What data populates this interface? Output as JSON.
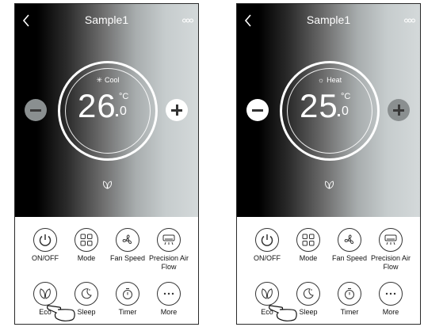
{
  "screens": [
    {
      "title": "Sample1",
      "mode_label": "Cool",
      "mode_icon": "snowflake-icon",
      "temp_int": "26",
      "temp_unit": "°C",
      "temp_dec": "0",
      "buttons": [
        "ON/OFF",
        "Mode",
        "Fan Speed",
        "Precision Air Flow",
        "Eco",
        "Sleep",
        "Timer",
        "More"
      ]
    },
    {
      "title": "Sample1",
      "mode_label": "Heat",
      "mode_icon": "sun-icon",
      "temp_int": "25",
      "temp_unit": "°C",
      "temp_dec": "0",
      "buttons": [
        "ON/OFF",
        "Mode",
        "Fan Speed",
        "Precision Air Flow",
        "Eco",
        "Sleep",
        "Timer",
        "More"
      ]
    }
  ],
  "colors": {
    "panel_dark": "#000000",
    "panel_light": "#d4d9da",
    "button_outline": "#333333",
    "adjust_inactive": "#8a8f90"
  }
}
